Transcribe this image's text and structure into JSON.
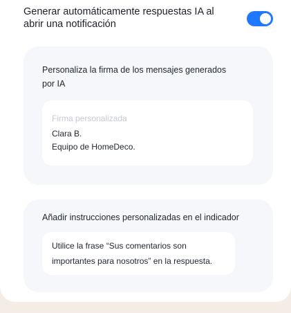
{
  "toggle": {
    "label": "Generar automáticamente respuestas IA al abrir una notificación",
    "enabled": true,
    "accent_color": "#1f78ff"
  },
  "signature": {
    "title": "Personaliza la firma de los mensajes generados por IA",
    "placeholder": "Firma personalizada",
    "lines": [
      "Clara B.",
      "Equipo de HomeDeco."
    ]
  },
  "instructions": {
    "title": "Añadir instrucciones personalizadas en el indicador",
    "text": "Utilice la frase “Sus comentarios son importantes para nosotros” en la respuesta."
  }
}
